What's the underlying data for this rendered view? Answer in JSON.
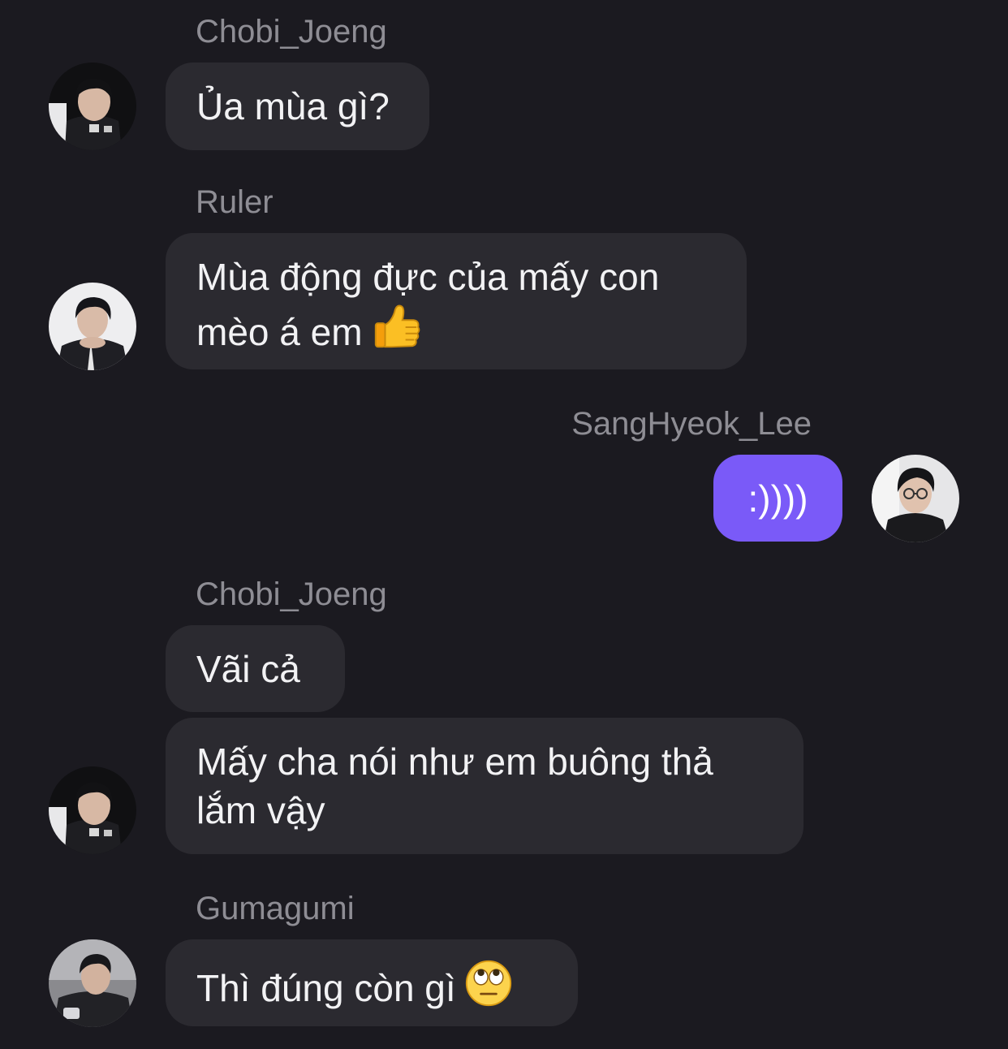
{
  "messages": [
    {
      "sender": "Chobi_Joeng",
      "lines": [
        "Ủa mùa gì?"
      ]
    },
    {
      "sender": "Ruler",
      "lines": [
        "Mùa động đực của mấy con",
        "mèo á em"
      ],
      "emoji": "thumbs-up-icon"
    },
    {
      "sender": "SangHyeok_Lee",
      "lines": [
        ":))))"
      ],
      "outgoing": true
    },
    {
      "sender": "Chobi_Joeng",
      "lines": [
        "Vãi cả"
      ]
    },
    {
      "sender": "",
      "lines": [
        "Mấy cha nói như em buông thả",
        "lắm vậy"
      ]
    },
    {
      "sender": "Gumagumi",
      "lines": [
        "Thì đúng còn gì"
      ],
      "emoji": "eye-roll-face-icon"
    }
  ],
  "colors": {
    "background": "#1b1a20",
    "incoming_bubble": "#2b2a30",
    "outgoing_bubble": "#7a5af8",
    "sender_name": "#8e8d94",
    "text": "#f2f2f4"
  }
}
